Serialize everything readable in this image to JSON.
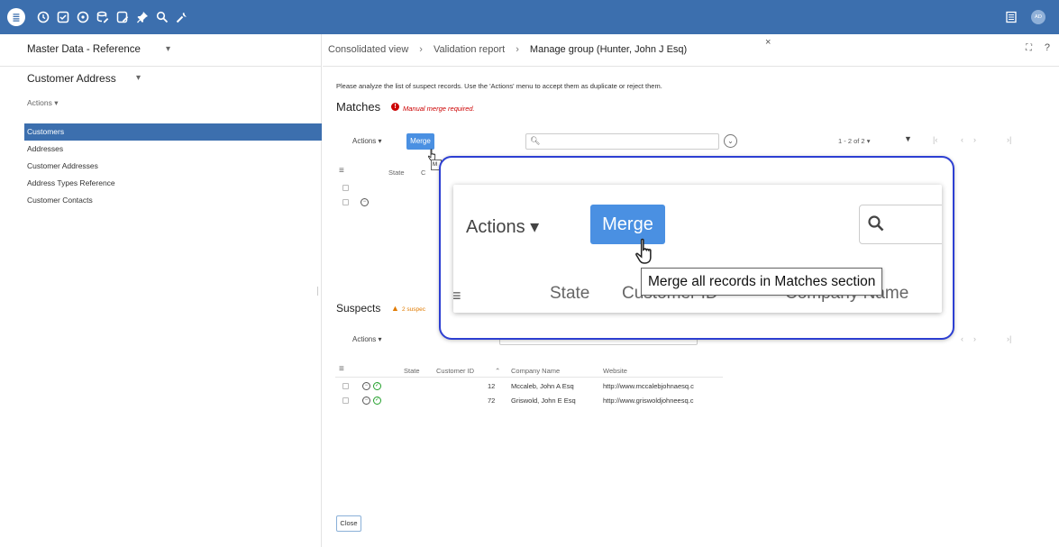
{
  "topbar": {
    "logo_icon": "app-logo-icon",
    "icons": [
      "history-icon",
      "task-check-icon",
      "dashboard-icon",
      "data-edit-icon",
      "task-edit-icon",
      "pin-icon",
      "search-icon",
      "wrench-icon"
    ],
    "right_icons": [
      "grid-menu-icon",
      "user-avatar-icon"
    ],
    "avatar_initials": "AD",
    "bg_color": "#3c6fae"
  },
  "left_panel": {
    "workspace_title": "Master Data - Reference",
    "entity_title": "Customer Address",
    "actions_label": "Actions",
    "items": [
      {
        "label": "Customers",
        "active": true
      },
      {
        "label": "Addresses",
        "active": false
      },
      {
        "label": "Customer Addresses",
        "active": false
      },
      {
        "label": "Address Types Reference",
        "active": false
      },
      {
        "label": "Customer Contacts",
        "active": false
      }
    ]
  },
  "breadcrumb": {
    "items": [
      "Consolidated view",
      "Validation report",
      "Manage group (Hunter, John J Esq)"
    ],
    "close_symbol": "×"
  },
  "main": {
    "instructions": "Please analyze the list of suspect records. Use the 'Actions' menu to accept them as duplicate or reject them.",
    "matches": {
      "title": "Matches",
      "warning": "Manual merge required.",
      "actions_label": "Actions",
      "merge_label": "Merge",
      "pager": "1 - 2 of 2",
      "columns": [
        "State",
        "C"
      ]
    },
    "suspects": {
      "title": "Suspects",
      "warning": "2 suspec",
      "actions_label": "Actions",
      "columns": [
        "State",
        "Customer ID",
        "Company Name",
        "Website"
      ],
      "rows": [
        {
          "customer_id": "12",
          "company_name": "Mccaleb, John A Esq",
          "website": "http://www.mccalebjohnaesq.c"
        },
        {
          "customer_id": "72",
          "company_name": "Griswold, John E Esq",
          "website": "http://www.griswoldjohneesq.c"
        }
      ]
    },
    "close_label": "Close"
  },
  "callout": {
    "actions_label": "Actions",
    "merge_label": "Merge",
    "tooltip": "Merge all records in Matches section",
    "col_state": "State",
    "col_customer_id": "Customer ID",
    "col_company": "Company Name",
    "mini_tooltip": "M",
    "border_color": "#2d3fd2"
  },
  "colors": {
    "accent": "#3c6fae",
    "button": "#4a90e2",
    "error": "#cc0000",
    "warning": "#e07a00",
    "ok": "#22a02a"
  }
}
